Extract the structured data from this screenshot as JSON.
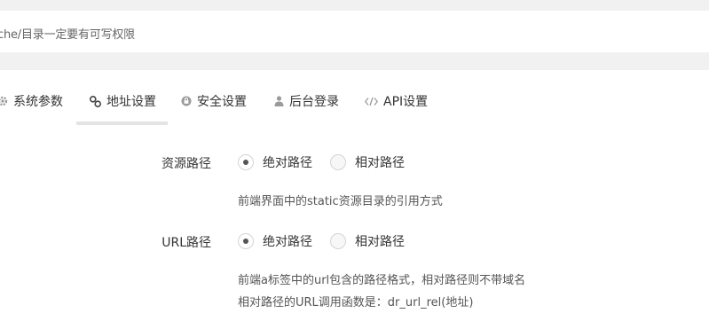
{
  "notice": {
    "text": "che/目录一定要有可写权限"
  },
  "tabs": [
    {
      "label": "系统参数",
      "icon": "gear-icon"
    },
    {
      "label": "地址设置",
      "icon": "link-icon",
      "active": true
    },
    {
      "label": "安全设置",
      "icon": "lock-icon"
    },
    {
      "label": "后台登录",
      "icon": "user-icon"
    },
    {
      "label": "API设置",
      "icon": "code-icon"
    }
  ],
  "form": {
    "resource_path": {
      "label": "资源路径",
      "options": [
        "绝对路径",
        "相对路径"
      ],
      "selected": "绝对路径",
      "help": "前端界面中的static资源目录的引用方式"
    },
    "url_path": {
      "label": "URL路径",
      "options": [
        "绝对路径",
        "相对路径"
      ],
      "selected": "绝对路径",
      "help_line1": "前端a标签中的url包含的路径格式，相对路径则不带域名",
      "help_line2": "相对路径的URL调用函数是：dr_url_rel(地址)"
    }
  },
  "colors": {
    "page_bg": "#f1f1f1",
    "panel_bg": "#ffffff",
    "active_tab_underline": "#e4e4e4",
    "icon_gray": "#999999"
  }
}
